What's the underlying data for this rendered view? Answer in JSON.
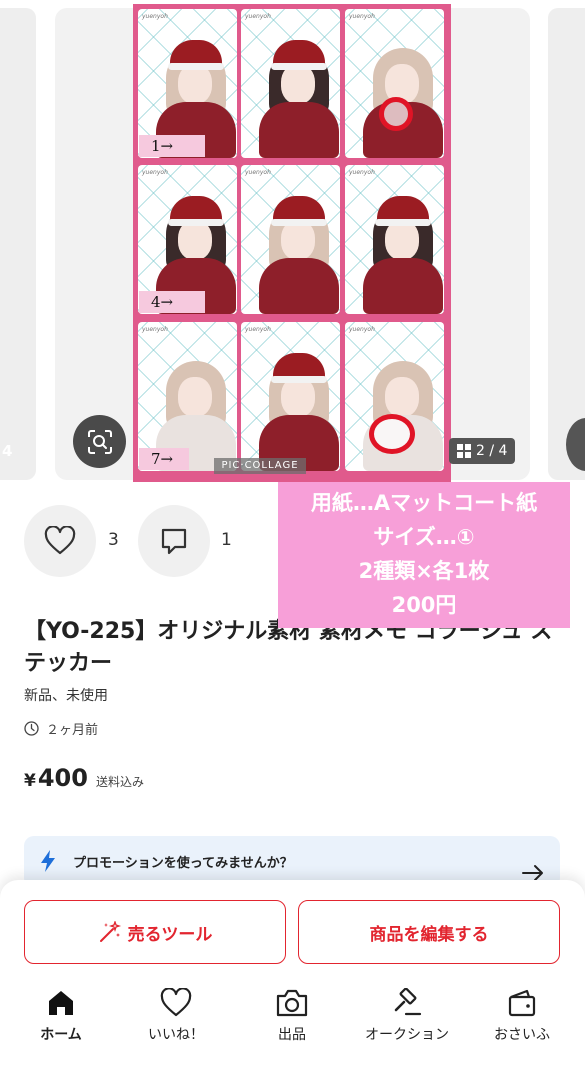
{
  "carousel": {
    "prev_count": "4",
    "page_indicator": "2 / 4",
    "collage_credit": "PIC·COLLAGE",
    "cell_signature": "yuenyoh",
    "number_tags": [
      "1→",
      "4→",
      "7→"
    ]
  },
  "overlay_note": {
    "lines": [
      "用紙…Aマットコート紙",
      "サイズ…①",
      "2種類×各1枚",
      "200円"
    ]
  },
  "actions": {
    "likes_count": "3",
    "comments_count": "1"
  },
  "product": {
    "title": "【YO-225】オリジナル素材 素材メモ コラージュ ステッカー",
    "condition": "新品、未使用",
    "posted_ago": "２ヶ月前",
    "price_currency": "¥",
    "price_value": "400",
    "shipping_note": "送料込み"
  },
  "promo": {
    "text": "プロモーションを使ってみませんか？"
  },
  "bottom_actions": {
    "sell_tool_label": "売るツール",
    "edit_label": "商品を編集する"
  },
  "tabbar": {
    "items": [
      {
        "label": "ホーム",
        "icon": "home-icon",
        "active": true
      },
      {
        "label": "いいね！",
        "icon": "heart-icon",
        "active": false
      },
      {
        "label": "出品",
        "icon": "camera-icon",
        "active": false
      },
      {
        "label": "オークション",
        "icon": "gavel-icon",
        "active": false
      },
      {
        "label": "おさいふ",
        "icon": "wallet-icon",
        "active": false
      }
    ]
  },
  "colors": {
    "accent_red": "#e2252f",
    "collage_pink": "#e05a8c",
    "overlay_pink": "#f79fd8",
    "promo_bg": "#eaf2fb"
  }
}
